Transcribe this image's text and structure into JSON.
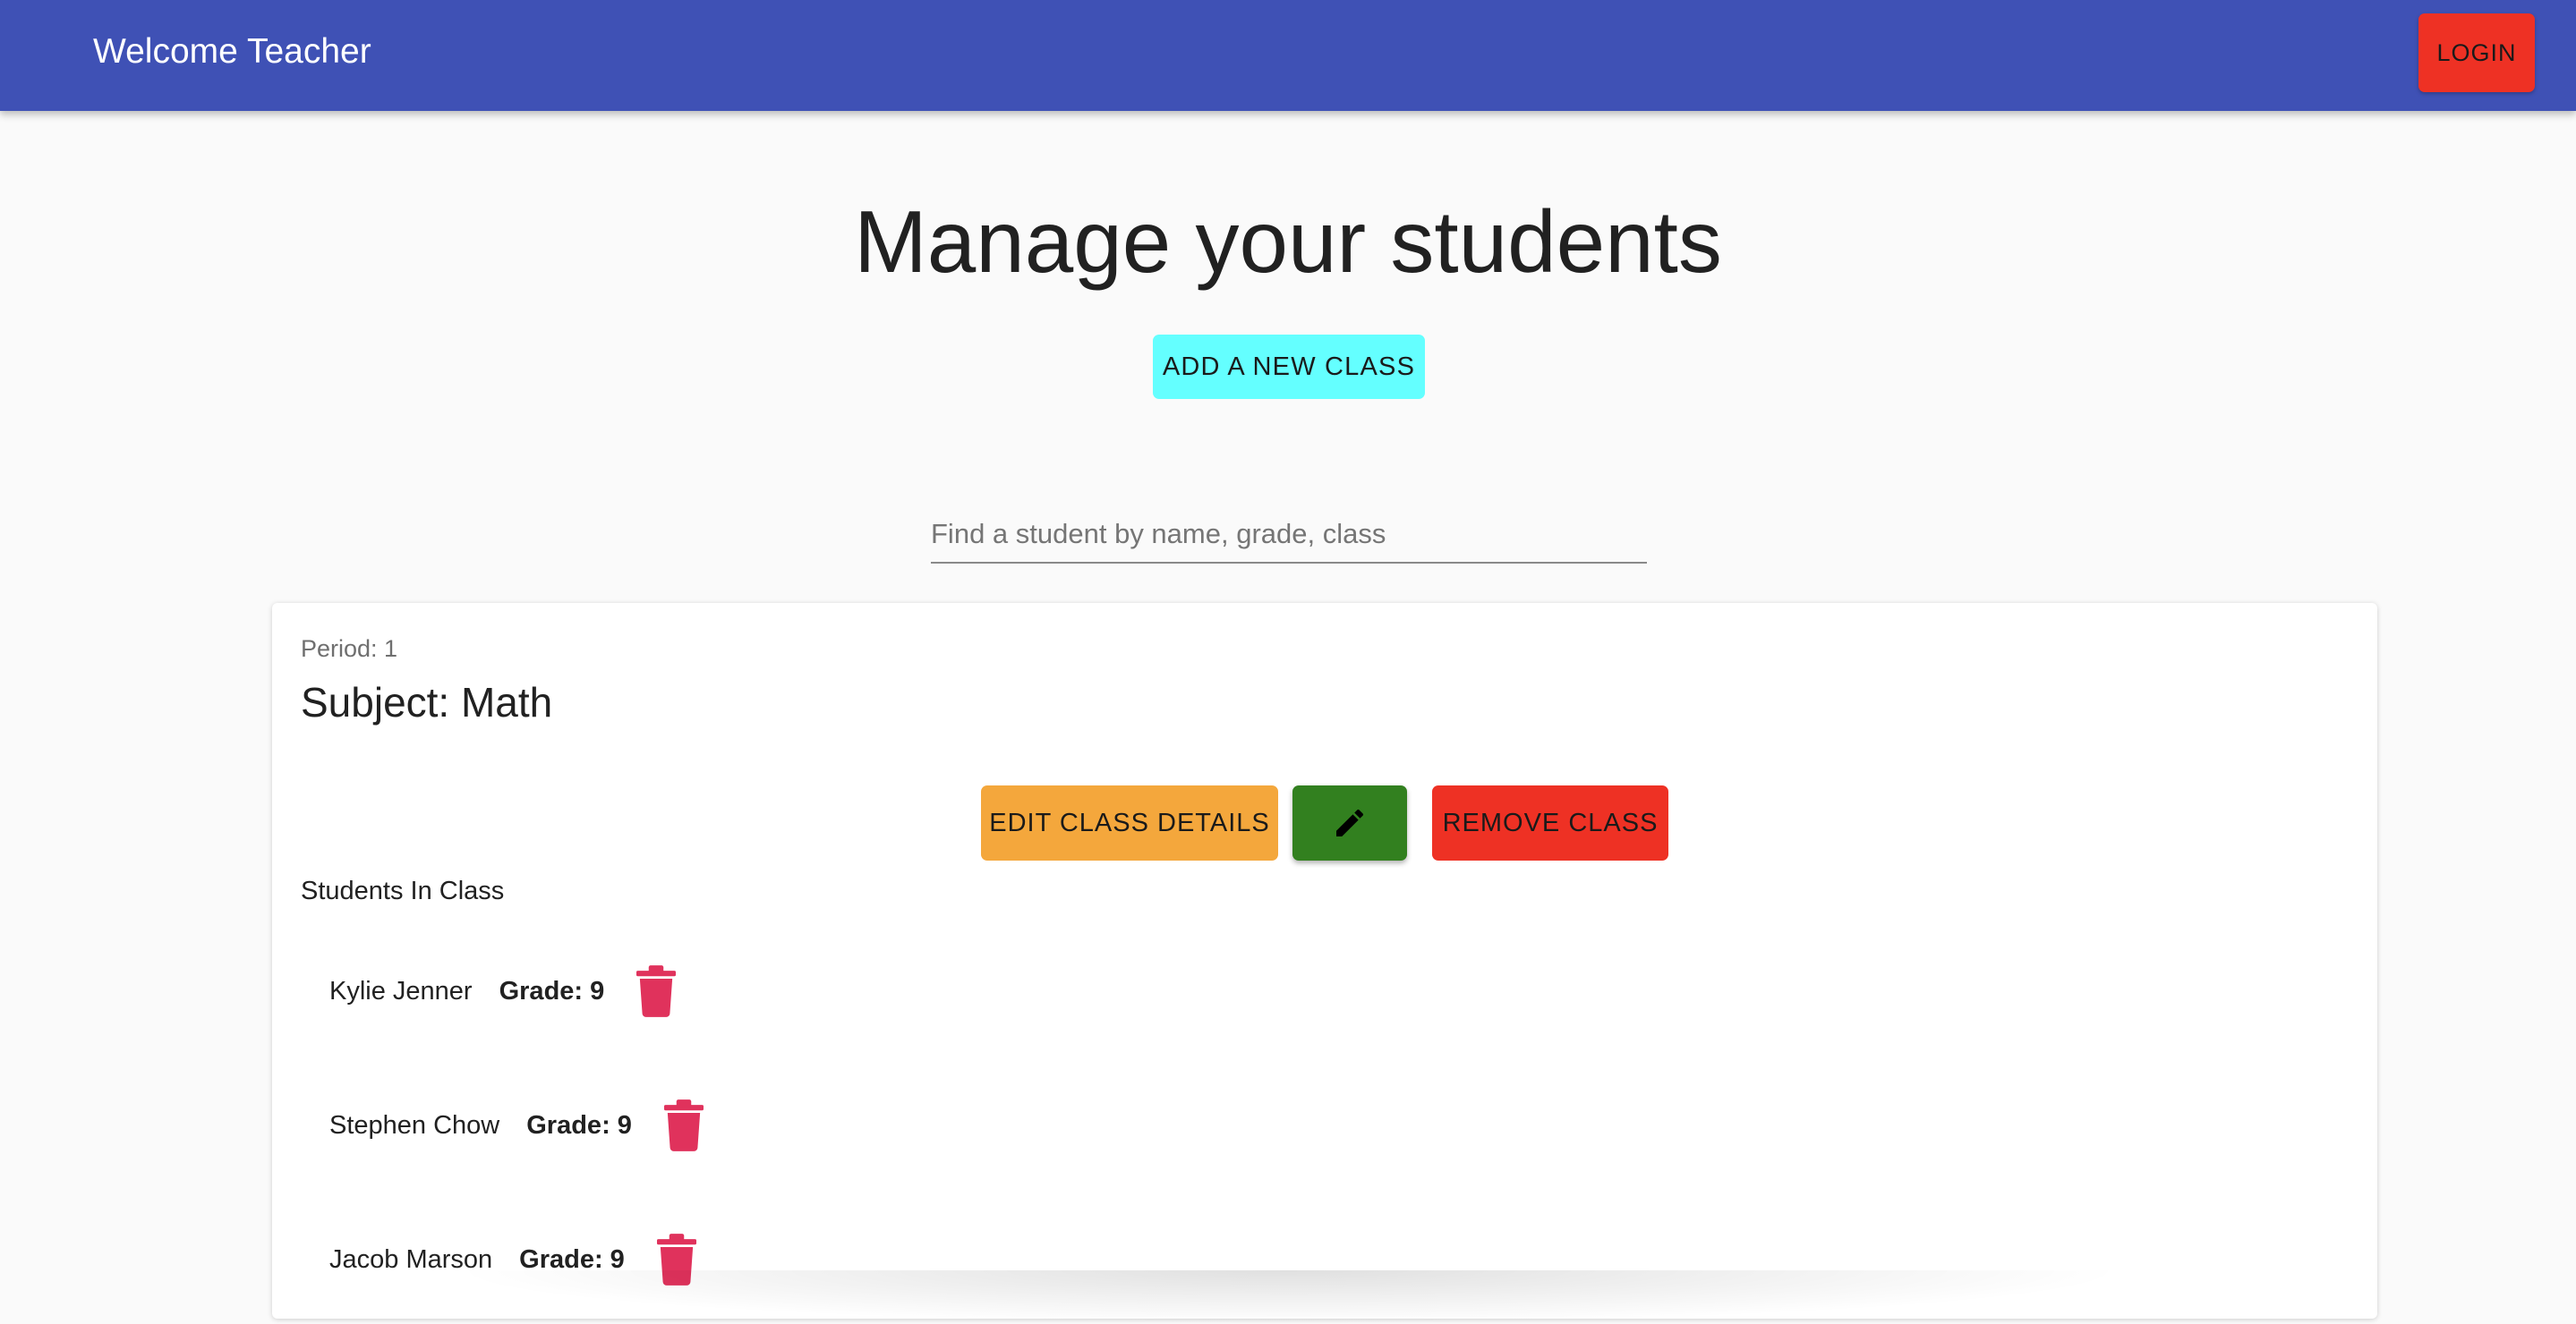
{
  "appbar": {
    "title": "Welcome Teacher",
    "login_label": "LOGIN",
    "color": "#3f51b5"
  },
  "main": {
    "title": "Manage your students",
    "add_class_label": "ADD A NEW CLASS",
    "search_placeholder": "Find a student by name, grade, class"
  },
  "class_card": {
    "period": "Period: 1",
    "subject": "Subject: Math",
    "edit_label": "EDIT CLASS DETAILS",
    "edit_icon": "pencil-icon",
    "remove_label": "REMOVE CLASS",
    "students_heading": "Students In Class",
    "students": [
      {
        "name": "Kylie Jenner",
        "grade": "Grade: 9"
      },
      {
        "name": "Stephen Chow",
        "grade": "Grade: 9"
      },
      {
        "name": "Jacob Marson",
        "grade": "Grade: 9"
      }
    ],
    "delete_icon": "trash-icon"
  },
  "colors": {
    "login": "#ee3124",
    "add_class": "#64ffff",
    "edit": "#f4a73c",
    "pencil": "#32801f",
    "remove": "#ee3124",
    "trash": "#e0325c"
  }
}
